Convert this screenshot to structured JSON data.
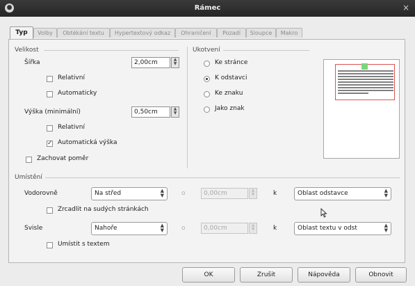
{
  "window": {
    "title": "Rámec"
  },
  "tabs": [
    "Typ",
    "Volby",
    "Obtékání textu",
    "Hypertextový odkaz",
    "Ohraničení",
    "Pozadí",
    "Sloupce",
    "Makro"
  ],
  "size": {
    "section_label": "Velikost",
    "width_label": "Šířka",
    "width_value": "2,00cm",
    "relative_label": "Relativní",
    "automatic_label": "Automaticky",
    "height_label": "Výška (minimální)",
    "height_value": "0,50cm",
    "height_relative_label": "Relativní",
    "auto_height_label": "Automatická výška",
    "keep_ratio_label": "Zachovat poměr"
  },
  "anchor": {
    "section_label": "Ukotvení",
    "options": [
      "Ke stránce",
      "K odstavci",
      "Ke znaku",
      "Jako znak"
    ],
    "selected": "K odstavci"
  },
  "position": {
    "section_label": "Umístění",
    "horizontal_label": "Vodorovně",
    "horizontal_value": "Na střed",
    "by_label": "o",
    "horizontal_by_value": "0,00cm",
    "to_label": "k",
    "horizontal_to_value": "Oblast odstavce",
    "mirror_label": "Zrcadlit na sudých stránkách",
    "vertical_label": "Svisle",
    "vertical_value": "Nahoře",
    "vertical_by_value": "0,00cm",
    "vertical_to_value": "Oblast textu v odst",
    "keep_in_text_label": "Umístit s textem"
  },
  "buttons": {
    "ok": "OK",
    "reset": "Zrušit",
    "help": "Nápověda",
    "revert": "Obnovit"
  },
  "checked": {
    "relative": false,
    "automatic": false,
    "height_relative": false,
    "auto_height": true,
    "keep_ratio": false,
    "mirror": false,
    "keep_in_text": false
  },
  "icons": {
    "title_icon": "app-icon",
    "close": "close-icon",
    "cursor": "mouse-pointer-icon"
  },
  "colors": {
    "titlebar": "#2f2f2f",
    "preview_frame": "#d9534f",
    "preview_anchor": "#7bd67b"
  }
}
